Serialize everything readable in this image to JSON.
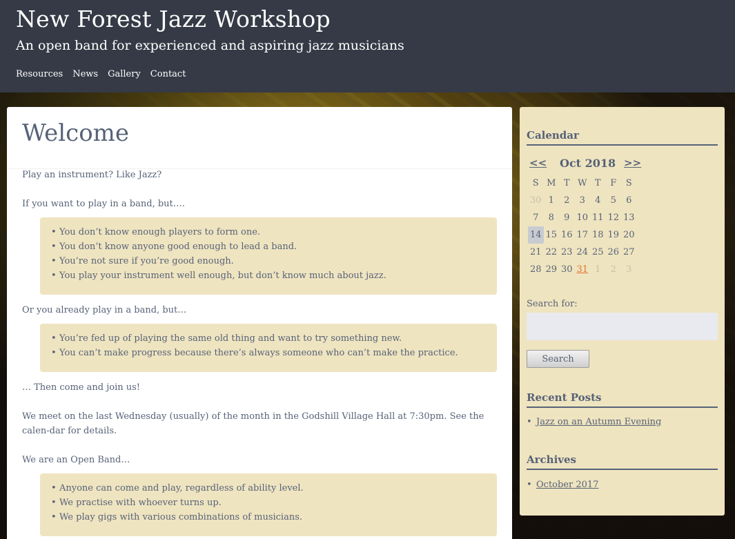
{
  "header": {
    "title": "New Forest Jazz Workshop",
    "tagline": "An open band for experienced and aspiring jazz musicians",
    "nav": [
      "Resources",
      "News",
      "Gallery",
      "Contact"
    ]
  },
  "main": {
    "page_title": "Welcome",
    "p1": "Play an instrument? Like Jazz?",
    "p2": "If you want to play in a band, but….",
    "list1": [
      "You don’t know enough players to form one.",
      "You don’t know anyone good enough to lead a band.",
      "You’re not sure if you’re good enough.",
      "You play your instrument well enough, but don’t know much about jazz."
    ],
    "p3": "Or you already play in a band, but…",
    "list2": [
      "You’re fed up of playing the same old thing and want to try something new.",
      "You can’t make progress because there’s always someone who can’t make the practice."
    ],
    "p4": "… Then come and join us!",
    "p5": "We meet on the last Wednesday (usually) of the month in the Godshill Village Hall at 7:30pm.  See the calen-dar for details.",
    "p6": "We are an Open Band…",
    "list3": [
      "Anyone can come and play, regardless of ability level.",
      "We practise with whoever turns up.",
      "We play gigs with various combinations of musicians."
    ]
  },
  "sidebar": {
    "calendar_title": "Calendar",
    "prev": "<<",
    "next": ">>",
    "month": "Oct 2018",
    "weekdays": [
      "S",
      "M",
      "T",
      "W",
      "T",
      "F",
      "S"
    ],
    "weeks": [
      [
        "30",
        "1",
        "2",
        "3",
        "4",
        "5",
        "6"
      ],
      [
        "7",
        "8",
        "9",
        "10",
        "11",
        "12",
        "13"
      ],
      [
        "14",
        "15",
        "16",
        "17",
        "18",
        "19",
        "20"
      ],
      [
        "21",
        "22",
        "23",
        "24",
        "25",
        "26",
        "27"
      ],
      [
        "28",
        "29",
        "30",
        "31",
        "1",
        "2",
        "3"
      ]
    ],
    "search_label": "Search for:",
    "search_value": "",
    "search_button": "Search",
    "recent_title": "Recent Posts",
    "recent_posts": [
      "Jazz on an Autumn Evening"
    ],
    "archives_title": "Archives",
    "archives": [
      "October 2017"
    ]
  },
  "colors": {
    "header_bg": "#353a46",
    "text": "#566277",
    "box_bg": "#efe4c0",
    "event_link": "#e0712e"
  }
}
